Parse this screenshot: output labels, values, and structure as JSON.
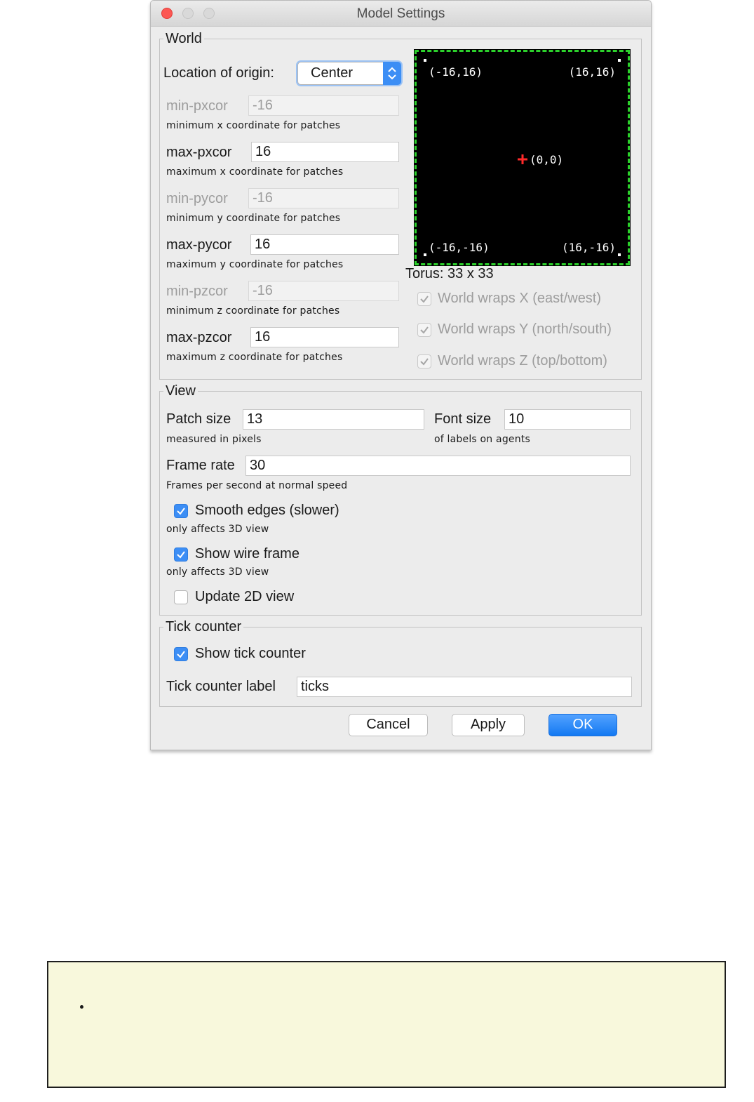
{
  "window": {
    "title": "Model Settings"
  },
  "world": {
    "legend": "World",
    "origin_label": "Location of origin:",
    "origin_value": "Center",
    "fields": {
      "min_pxcor": {
        "label": "min-pxcor",
        "value": "-16",
        "hint": "minimum x coordinate for patches"
      },
      "max_pxcor": {
        "label": "max-pxcor",
        "value": "16",
        "hint": "maximum x coordinate for patches"
      },
      "min_pycor": {
        "label": "min-pycor",
        "value": "-16",
        "hint": "minimum y coordinate for patches"
      },
      "max_pycor": {
        "label": "max-pycor",
        "value": "16",
        "hint": "maximum y coordinate for patches"
      },
      "min_pzcor": {
        "label": "min-pzcor",
        "value": "-16",
        "hint": "minimum z coordinate for patches"
      },
      "max_pzcor": {
        "label": "max-pzcor",
        "value": "16",
        "hint": "maximum z coordinate for patches"
      }
    },
    "preview": {
      "top_left": "(-16,16)",
      "top_right": "(16,16)",
      "center": "(0,0)",
      "bottom_left": "(-16,-16)",
      "bottom_right": "(16,-16)"
    },
    "torus_label": "Torus: 33 x 33",
    "wraps": {
      "x": {
        "label": "World wraps X (east/west)",
        "checked": true
      },
      "y": {
        "label": "World wraps Y (north/south)",
        "checked": true
      },
      "z": {
        "label": "World wraps Z (top/bottom)",
        "checked": true
      }
    }
  },
  "view": {
    "legend": "View",
    "patch_size": {
      "label": "Patch size",
      "value": "13",
      "hint": "measured in pixels"
    },
    "font_size": {
      "label": "Font size",
      "value": "10",
      "hint": "of labels on agents"
    },
    "frame_rate": {
      "label": "Frame rate",
      "value": "30",
      "hint": "Frames per second at normal speed"
    },
    "smooth_edges": {
      "label": "Smooth edges (slower)",
      "checked": true,
      "hint": "only affects 3D view"
    },
    "wire_frame": {
      "label": "Show wire frame",
      "checked": true,
      "hint": "only affects 3D view"
    },
    "update_2d": {
      "label": "Update 2D view",
      "checked": false
    }
  },
  "tick": {
    "legend": "Tick counter",
    "show": {
      "label": "Show tick counter",
      "checked": true
    },
    "label_label": "Tick counter label",
    "label_value": "ticks"
  },
  "buttons": {
    "cancel": "Cancel",
    "apply": "Apply",
    "ok": "OK"
  },
  "colors": {
    "accent": "#3c8ef5",
    "preview_border": "#2bd12b",
    "origin_marker": "#ff2a2a",
    "note_bg": "#f8f8dc"
  }
}
